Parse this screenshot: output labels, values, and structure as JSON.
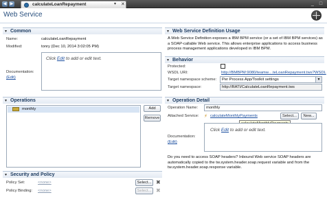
{
  "tab": {
    "title": "calculateLoanRepayment",
    "dropdown_glyph": "▾",
    "close_glyph": "✕"
  },
  "nav": {
    "back_glyph": "◀",
    "forward_glyph": "▶"
  },
  "window": {
    "min_glyph": "_",
    "max_glyph": "□"
  },
  "header": {
    "title": "Web Service"
  },
  "common": {
    "title": "Common",
    "name_label": "Name:",
    "name_value": "calculateLoanRepayment",
    "modified_label": "Modified:",
    "modified_value": "tonry (Dec 10, 2014 3:02:05 PM)",
    "documentation_label": "Documentation:",
    "edit_link": "(Edit)",
    "doc_prefix": "Click ",
    "doc_link": "Edit",
    "doc_suffix": " to add or edit text."
  },
  "operations": {
    "title": "Operations",
    "items": [
      "monthly"
    ],
    "add_label": "Add",
    "remove_label": "Remove"
  },
  "security": {
    "title": "Security and Policy",
    "policy_set_label": "Policy Set:",
    "policy_set_value": "<none>",
    "policy_binding_label": "Policy Binding:",
    "policy_binding_value": "<none>",
    "select_label": "Select..."
  },
  "wsdl_usage": {
    "title": "Web Service Definition Usage",
    "text": "A Web Service Definition exposes a IBM BPM service (or a set of IBM BPM services) as a SOAP-callable Web service. This allows enterprise applications to access business process management applications developed in IBM BPM."
  },
  "behavior": {
    "title": "Behavior",
    "protected_label": "Protected:",
    "protected_checked": false,
    "wsdl_uri_label": "WSDL URI:",
    "wsdl_uri_value": "http://BMBPM:9080/teamw....teLoanRepayment.tws?WSDL",
    "scheme_label": "Target namespace scheme:",
    "scheme_value": "Per Process App/Toolkit settings",
    "namespace_label": "Target namespace:",
    "namespace_value": "http://RATI/CalculateLoanRepayment.tws"
  },
  "op_detail": {
    "title": "Operation Detail",
    "op_name_label": "Operation Name:",
    "op_name_value": "monthly",
    "attached_label": "Attached Service:",
    "attached_value": "calculateMonthlyPayments",
    "select_label": "Select...",
    "new_label": "New...",
    "tooltip": "calculateMonthlyPayments",
    "documentation_label": "Documentation:",
    "edit_link": "(Edit)",
    "doc_prefix": "Click ",
    "doc_link": "Edit",
    "doc_suffix": " to add or edit text.",
    "soap_note": "Do you need to access SOAP headers? Inbound Web service SOAP headers are automatically copied to the tw.system.header.soap.request variable and from the tw.system.header.soap.response variable."
  },
  "colors": {
    "accent": "#274e7d",
    "link": "#1c4fa0",
    "section_bg": "#e3eaf3",
    "tabbar": "#3a3a3a"
  }
}
